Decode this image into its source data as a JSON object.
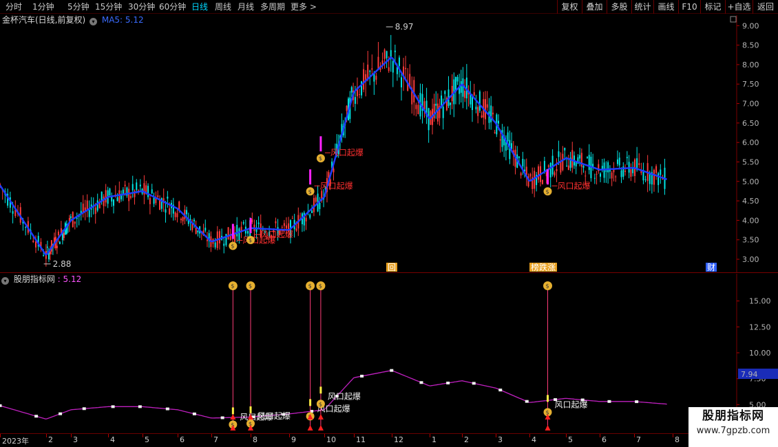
{
  "toolbar": {
    "periods": [
      "分时",
      "1分钟",
      "5分钟",
      "15分钟",
      "30分钟",
      "60分钟",
      "日线",
      "周线",
      "月线",
      "多周期",
      "更多 >"
    ],
    "active_period": "日线",
    "buttons": [
      "复权",
      "叠加",
      "多股",
      "统计",
      "画线",
      "F10",
      "标记",
      "+自选",
      "返回"
    ]
  },
  "main_panel": {
    "stock_title": "金杯汽车(日线,前复权)",
    "indicator_name": "MA5:",
    "indicator_value": "5.12",
    "high_label": "8.97",
    "low_label": "2.88",
    "signal_text": "风口起爆",
    "event_markers": [
      "回",
      "榜跌涨",
      "财"
    ],
    "y_axis_labels": [
      "9.00",
      "8.50",
      "8.00",
      "7.50",
      "7.00",
      "6.50",
      "6.00",
      "5.50",
      "5.00",
      "4.50",
      "4.00",
      "3.50",
      "3.00"
    ]
  },
  "sub_panel": {
    "title": "股朋指标网",
    "value": "5.12",
    "y_axis_labels": [
      "15.00",
      "12.50",
      "10.00",
      "7.50",
      "5.00"
    ],
    "current_value": "7.94",
    "signal_text": "风口起爆"
  },
  "date_axis": {
    "labels": [
      "2023年",
      "2",
      "3",
      "4",
      "5",
      "6",
      "7",
      "8",
      "9",
      "10",
      "11",
      "12",
      "1",
      "2",
      "3",
      "4",
      "5",
      "6",
      "7",
      "8"
    ]
  },
  "watermark": {
    "line1": "股朋指标网",
    "line2": "www.7gpzb.com"
  },
  "colors": {
    "background": "#000000",
    "up_candle": "#ff3c3c",
    "down_candle": "#00e5e5",
    "ma_line": "#1e3cff",
    "signal_text": "#ff3030",
    "signal_line": "#ff3c78",
    "sub_line": "#c020c0",
    "grid": "#7a0000",
    "current_value_bg": "#1a2cb8"
  },
  "chart_data": [
    {
      "type": "candlestick",
      "title": "金杯汽车(日线,前复权)",
      "ylim": [
        2.7,
        9.2
      ],
      "x_range": [
        "2023-01",
        "2024-08"
      ],
      "series": [
        {
          "name": "MA5",
          "x": [
            "2023-01",
            "2023-02",
            "2023-03",
            "2023-04",
            "2023-05",
            "2023-06",
            "2023-07",
            "2023-08",
            "2023-09",
            "2023-10",
            "2023-11",
            "2023-12",
            "2024-01",
            "2024-02",
            "2024-03",
            "2024-04",
            "2024-05",
            "2024-06",
            "2024-07",
            "2024-08"
          ],
          "values": [
            4.9,
            3.1,
            4.0,
            4.6,
            4.75,
            4.3,
            3.45,
            3.8,
            3.75,
            4.6,
            7.3,
            8.2,
            6.6,
            7.5,
            6.5,
            5.0,
            5.6,
            5.3,
            5.35,
            5.0
          ]
        }
      ],
      "annotations": [
        {
          "label": "8.97",
          "x": "2023-12",
          "y": 8.97
        },
        {
          "label": "2.88",
          "x": "2023-02",
          "y": 2.88
        },
        {
          "label": "风口起爆",
          "x": "2023-07"
        },
        {
          "label": "风口起爆",
          "x": "2023-08"
        },
        {
          "label": "风口起爆",
          "x": "2023-10"
        },
        {
          "label": "风口起爆",
          "x": "2023-11"
        },
        {
          "label": "风口起爆",
          "x": "2024-04"
        }
      ]
    },
    {
      "type": "line",
      "title": "股朋指标网",
      "ylim": [
        2.5,
        17.5
      ],
      "x": [
        "2023-01",
        "2023-02",
        "2023-03",
        "2023-04",
        "2023-05",
        "2023-06",
        "2023-07",
        "2023-08",
        "2023-09",
        "2023-10",
        "2023-11",
        "2023-12",
        "2024-01",
        "2024-02",
        "2024-03",
        "2024-04",
        "2024-05",
        "2024-06",
        "2024-07",
        "2024-08"
      ],
      "series": [
        {
          "name": "股朋指标网",
          "values": [
            4.9,
            3.6,
            4.5,
            4.8,
            4.8,
            4.5,
            3.7,
            3.8,
            4.1,
            4.5,
            7.6,
            8.3,
            6.8,
            7.3,
            6.6,
            5.2,
            5.6,
            5.3,
            5.3,
            5.0
          ]
        }
      ],
      "annotations": [
        {
          "label": "风口起爆",
          "x": "2023-07"
        },
        {
          "label": "风口起爆",
          "x": "2023-08"
        },
        {
          "label": "风口起爆",
          "x": "2023-10"
        },
        {
          "label": "风口起爆",
          "x": "2023-11"
        },
        {
          "label": "风口起爆",
          "x": "2024-04"
        }
      ]
    }
  ]
}
